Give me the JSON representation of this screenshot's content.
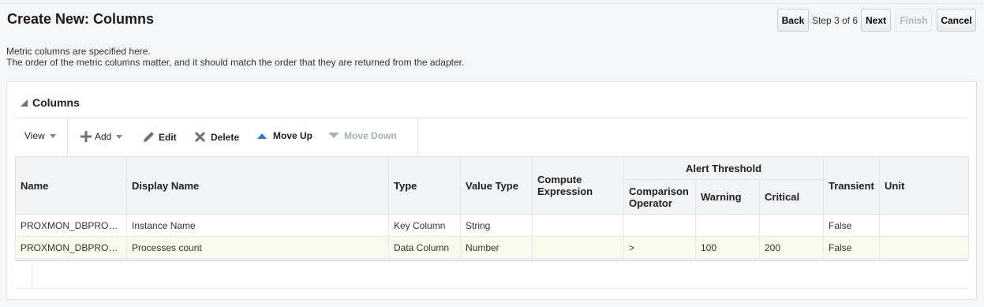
{
  "page": {
    "title": "Create New: Columns"
  },
  "train": {
    "back": "Back",
    "step": "Step 3 of 6",
    "next": "Next",
    "finish": "Finish",
    "cancel": "Cancel"
  },
  "description": {
    "line1": "Metric columns are specified here.",
    "line2": "The order of the metric columns matter, and it should match the order that they are returned from the adapter."
  },
  "section": {
    "title": "Columns"
  },
  "toolbar": {
    "view": "View",
    "add": "Add",
    "edit": "Edit",
    "delete": "Delete",
    "move_up": "Move Up",
    "move_down": "Move Down"
  },
  "table": {
    "headers": {
      "name": "Name",
      "display_name": "Display Name",
      "type": "Type",
      "value_type": "Value Type",
      "compute_expression": "Compute Expression",
      "alert_threshold": "Alert Threshold",
      "comparison_operator": "Comparison Operator",
      "warning": "Warning",
      "critical": "Critical",
      "transient": "Transient",
      "unit": "Unit"
    },
    "rows": [
      {
        "name": "PROXMON_DBPRO…",
        "display_name": "Instance Name",
        "type": "Key Column",
        "value_type": "String",
        "compute_expression": "",
        "comparison_operator": "",
        "warning": "",
        "critical": "",
        "transient": "False",
        "unit": ""
      },
      {
        "name": "PROXMON_DBPRO…",
        "display_name": "Processes count",
        "type": "Data Column",
        "value_type": "Number",
        "compute_expression": "",
        "comparison_operator": ">",
        "warning": "100",
        "critical": "200",
        "transient": "False",
        "unit": ""
      }
    ]
  }
}
